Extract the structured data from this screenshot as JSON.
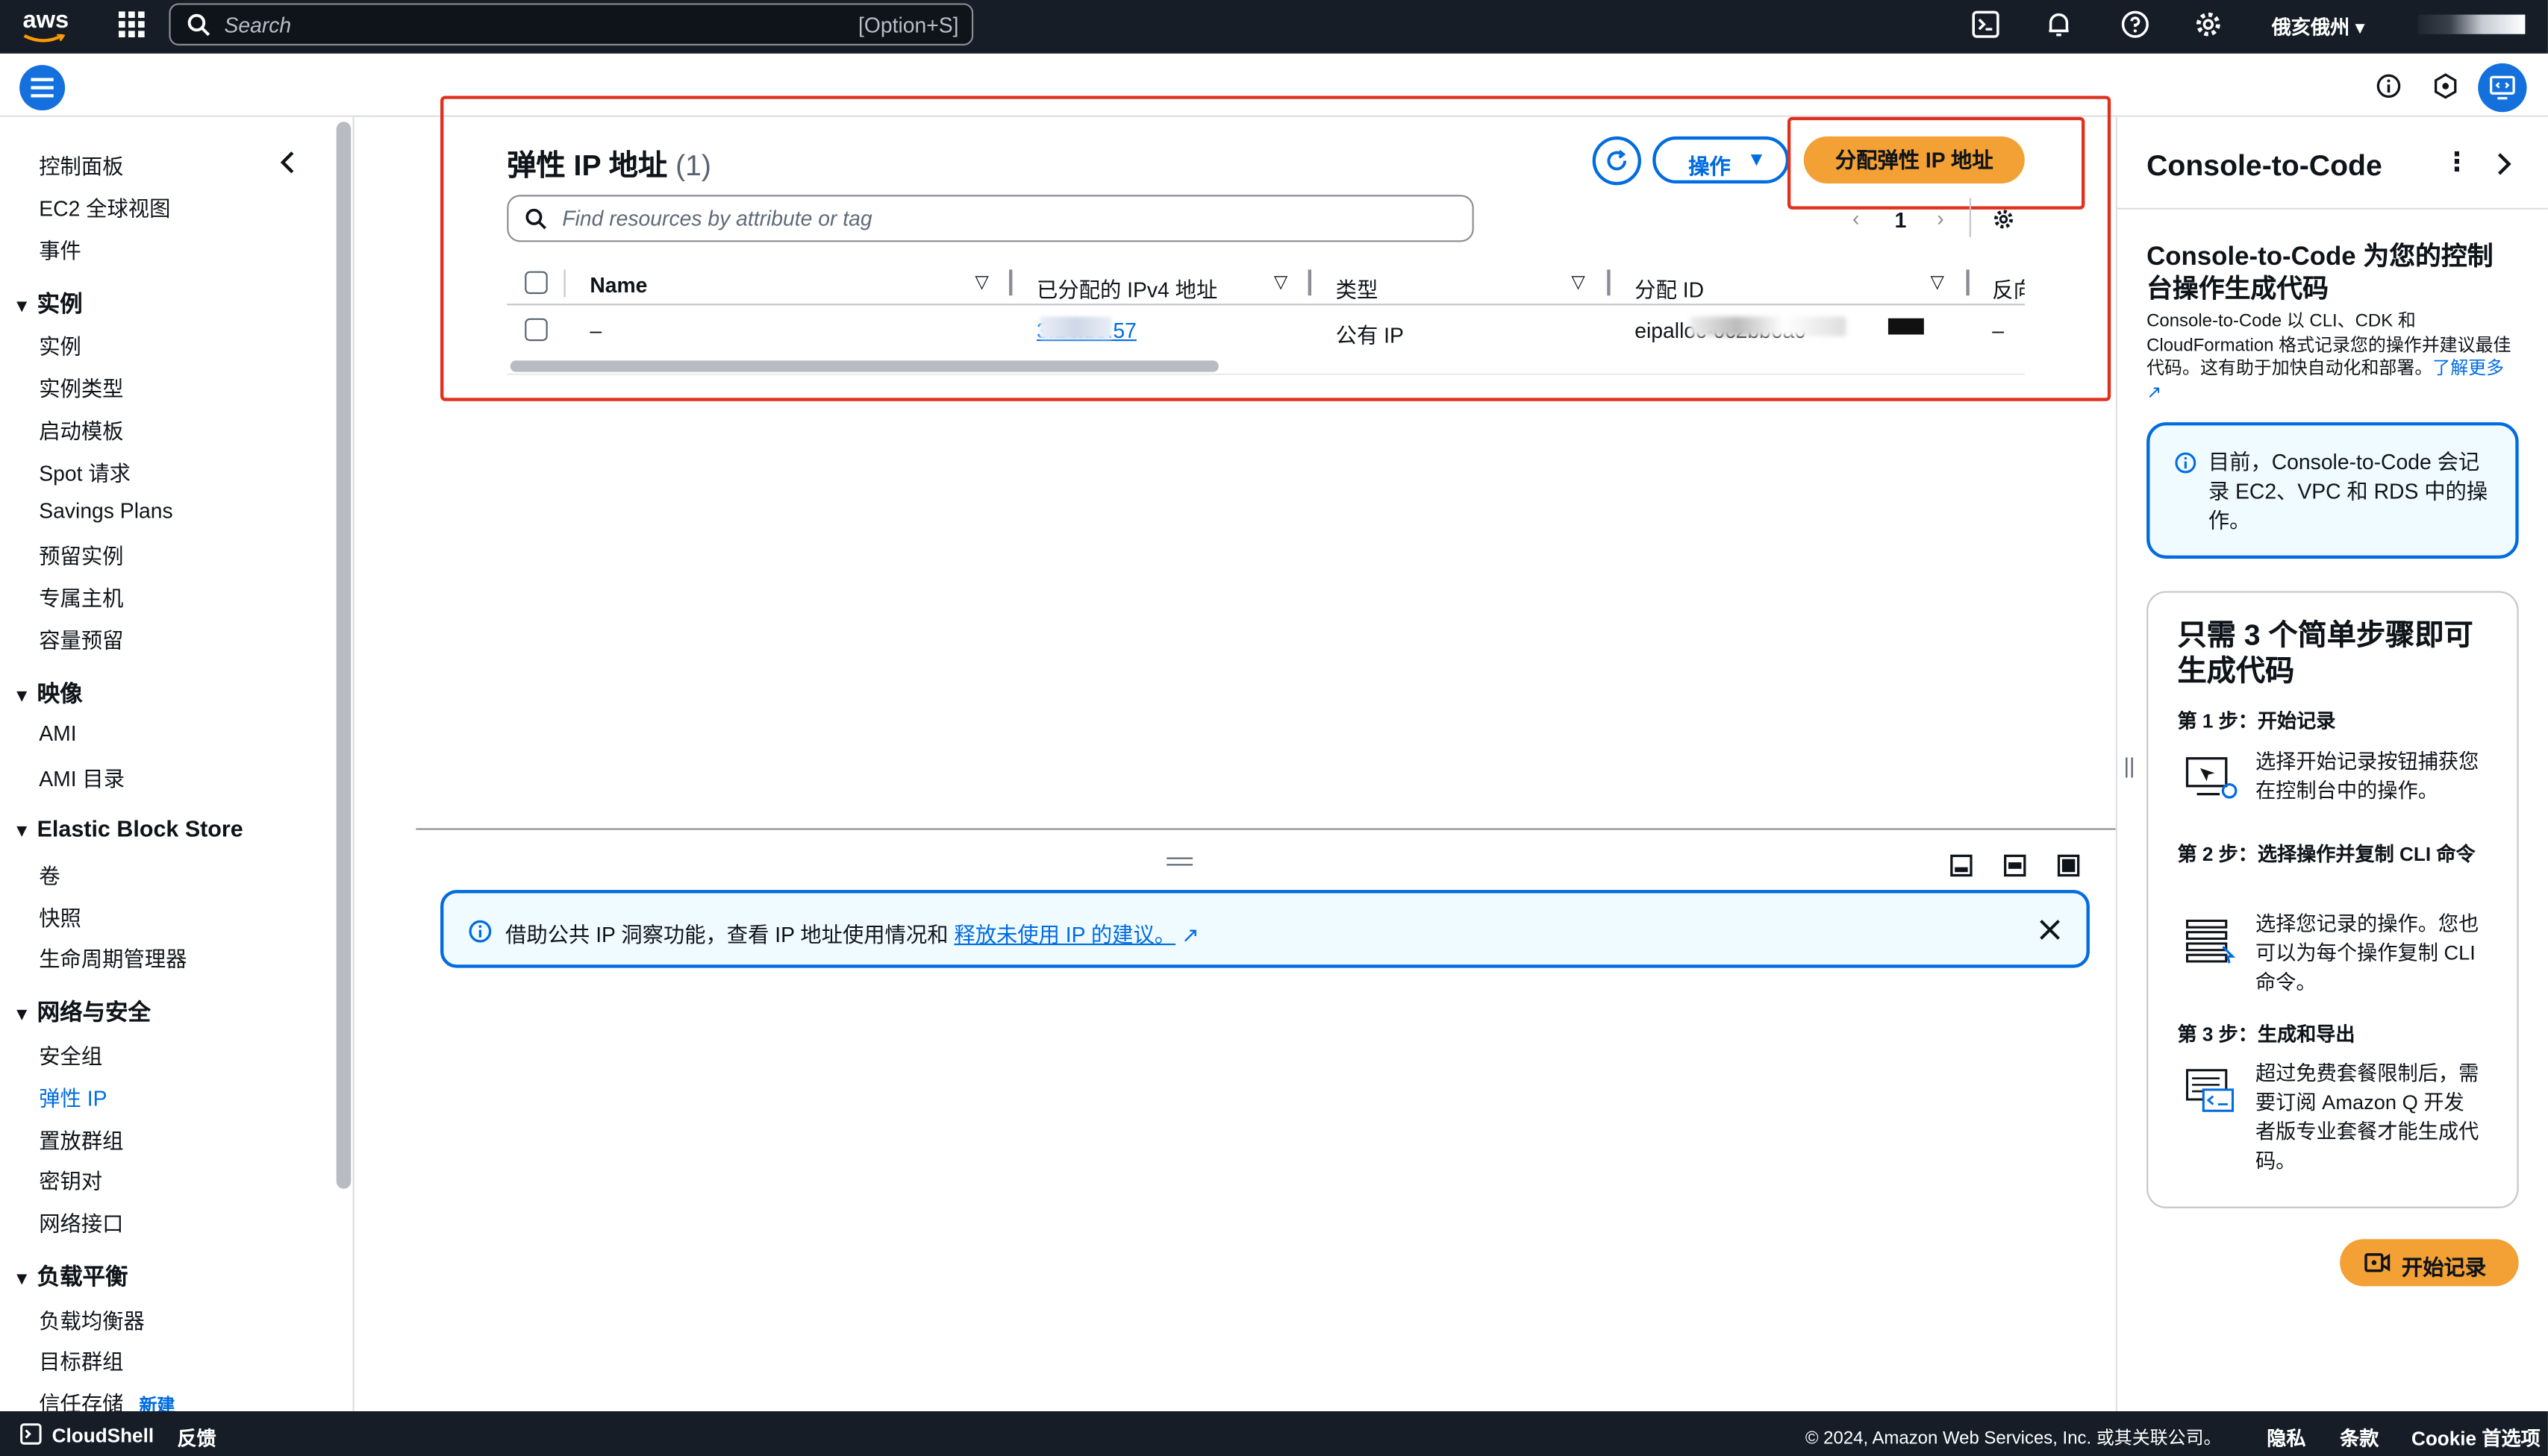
{
  "topbar": {
    "logo_text": "aws",
    "search_placeholder": "Search",
    "search_shortcut": "[Option+S]",
    "region": "俄亥俄州",
    "icons": [
      "grid-icon",
      "cloudshell-icon",
      "bell-icon",
      "help-icon",
      "gear-icon"
    ]
  },
  "sidebar": {
    "items": [
      {
        "label": "控制面板",
        "type": "item"
      },
      {
        "label": "EC2 全球视图",
        "type": "item"
      },
      {
        "label": "事件",
        "type": "item"
      },
      {
        "label": "实例",
        "type": "section"
      },
      {
        "label": "实例",
        "type": "item"
      },
      {
        "label": "实例类型",
        "type": "item"
      },
      {
        "label": "启动模板",
        "type": "item"
      },
      {
        "label": "Spot 请求",
        "type": "item"
      },
      {
        "label": "Savings Plans",
        "type": "item"
      },
      {
        "label": "预留实例",
        "type": "item"
      },
      {
        "label": "专属主机",
        "type": "item"
      },
      {
        "label": "容量预留",
        "type": "item"
      },
      {
        "label": "映像",
        "type": "section"
      },
      {
        "label": "AMI",
        "type": "item"
      },
      {
        "label": "AMI 目录",
        "type": "item"
      },
      {
        "label": "Elastic Block Store",
        "type": "section"
      },
      {
        "label": "卷",
        "type": "item"
      },
      {
        "label": "快照",
        "type": "item"
      },
      {
        "label": "生命周期管理器",
        "type": "item"
      },
      {
        "label": "网络与安全",
        "type": "section"
      },
      {
        "label": "安全组",
        "type": "item"
      },
      {
        "label": "弹性 IP",
        "type": "item",
        "active": true
      },
      {
        "label": "置放群组",
        "type": "item"
      },
      {
        "label": "密钥对",
        "type": "item"
      },
      {
        "label": "网络接口",
        "type": "item"
      },
      {
        "label": "负载平衡",
        "type": "section"
      },
      {
        "label": "负载均衡器",
        "type": "item"
      },
      {
        "label": "目标群组",
        "type": "item"
      },
      {
        "label": "信任存储",
        "type": "item"
      }
    ],
    "new_badge": "新建"
  },
  "main": {
    "title": "弹性 IP 地址",
    "count": "(1)",
    "actions_label": "操作",
    "allocate_label": "分配弹性 IP 地址",
    "filter_placeholder": "Find resources by attribute or tag",
    "page_number": "1",
    "columns": [
      "Name",
      "已分配的 IPv4 地址",
      "类型",
      "分配 ID",
      "反向"
    ],
    "row": {
      "name": "–",
      "ipv4": "3.14.15.57",
      "type": "公有 IP",
      "alloc_id": "eipalloc-0c2bb6a0",
      "reverse": "–"
    }
  },
  "banner": {
    "text": "借助公共 IP 洞察功能，查看 IP 地址使用情况和",
    "link": "释放未使用 IP 的建议。"
  },
  "right_panel": {
    "title": "Console-to-Code",
    "heading": "Console-to-Code 为您的控制台操作生成代码",
    "desc": "Console-to-Code 以 CLI、CDK 和 CloudFormation 格式记录您的操作并建议最佳代码。这有助于加快自动化和部署。",
    "learn_more": "了解更多",
    "info": "目前，Console-to-Code 会记录 EC2、VPC 和 RDS 中的操作。",
    "steps_title": "只需 3 个简单步骤即可生成代码",
    "step1_title": "第 1 步：开始记录",
    "step1_text": "选择开始记录按钮捕获您在控制台中的操作。",
    "step2_title": "第 2 步：选择操作并复制 CLI 命令",
    "step2_text": "选择您记录的操作。您也可以为每个操作复制 CLI 命令。",
    "step3_title": "第 3 步：生成和导出",
    "step3_text": "超过免费套餐限制后，需要订阅 Amazon Q 开发者版专业套餐才能生成代码。",
    "record_label": "开始记录"
  },
  "footer": {
    "cloudshell": "CloudShell",
    "feedback": "反馈",
    "copyright": "© 2024, Amazon Web Services, Inc. 或其关联公司。",
    "privacy": "隐私",
    "terms": "条款",
    "cookie": "Cookie 首选项"
  },
  "colors": {
    "nav_dark": "#161d26",
    "accent": "#006ce0",
    "orange": "#f3a035",
    "highlight": "#e0301e"
  }
}
